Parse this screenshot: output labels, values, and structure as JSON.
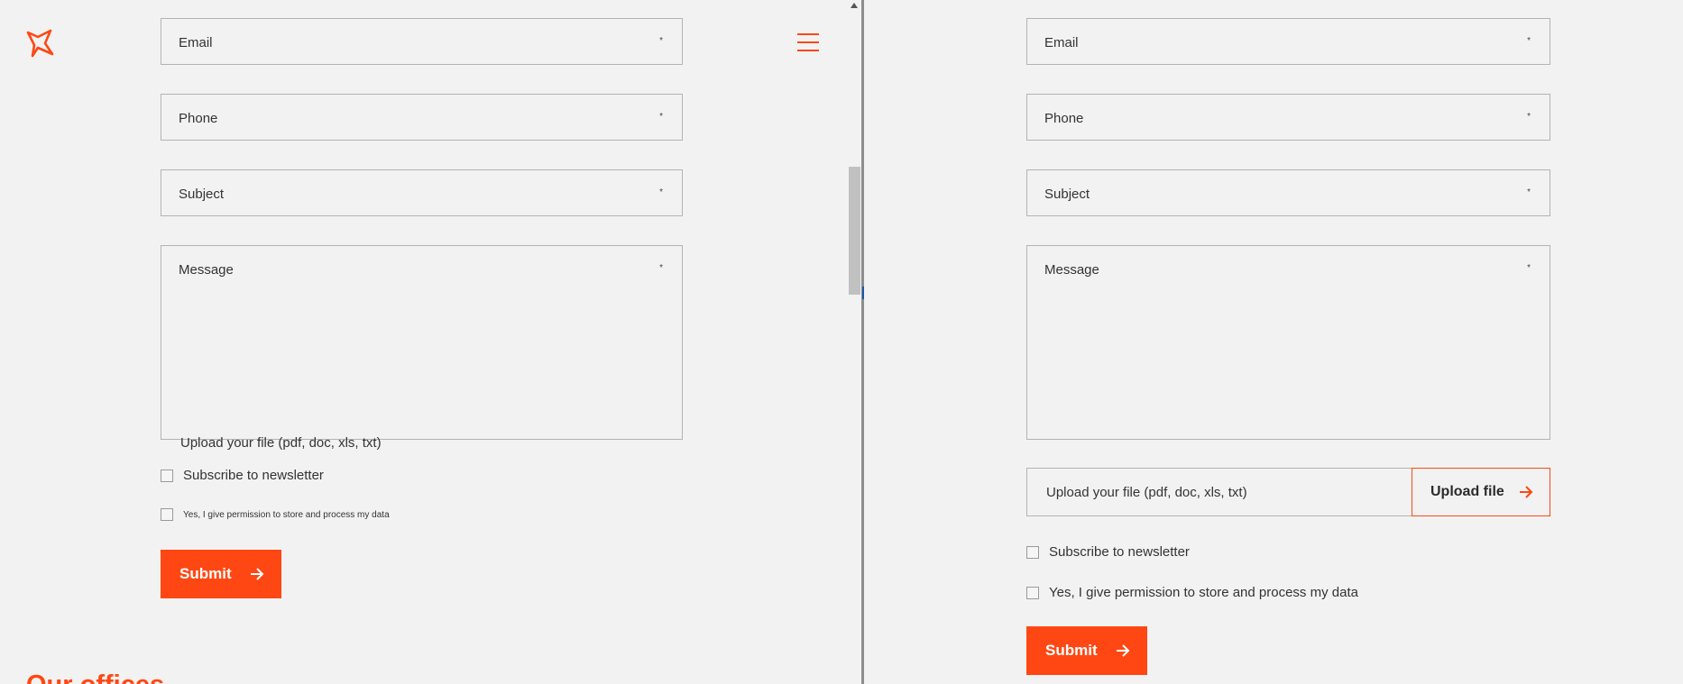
{
  "colors": {
    "accent": "#ff4713",
    "background": "#f2f2f2",
    "border": "#b3b3b3"
  },
  "left": {
    "logo_icon": "sparkle-logo-icon",
    "menu_icon": "hamburger-menu-icon",
    "fields": [
      {
        "label": "Email",
        "required": "*"
      },
      {
        "label": "Phone",
        "required": "*"
      },
      {
        "label": "Subject",
        "required": "*"
      },
      {
        "label": "Message",
        "required": "*"
      }
    ],
    "upload_label": "Upload your file (pdf, doc, xls, txt)",
    "newsletter_label": "Subscribe to newsletter",
    "permission_label": "Yes, I give permission to store and process my data",
    "submit_label": "Submit",
    "offices_heading": "Our offices"
  },
  "right": {
    "fields": [
      {
        "label": "Email",
        "required": "*"
      },
      {
        "label": "Phone",
        "required": "*"
      },
      {
        "label": "Subject",
        "required": "*"
      },
      {
        "label": "Message",
        "required": "*"
      }
    ],
    "upload_label": "Upload your file (pdf, doc, xls, txt)",
    "upload_button": "Upload file",
    "newsletter_label": "Subscribe to newsletter",
    "permission_label": "Yes, I give permission to store and process my data",
    "submit_label": "Submit"
  }
}
